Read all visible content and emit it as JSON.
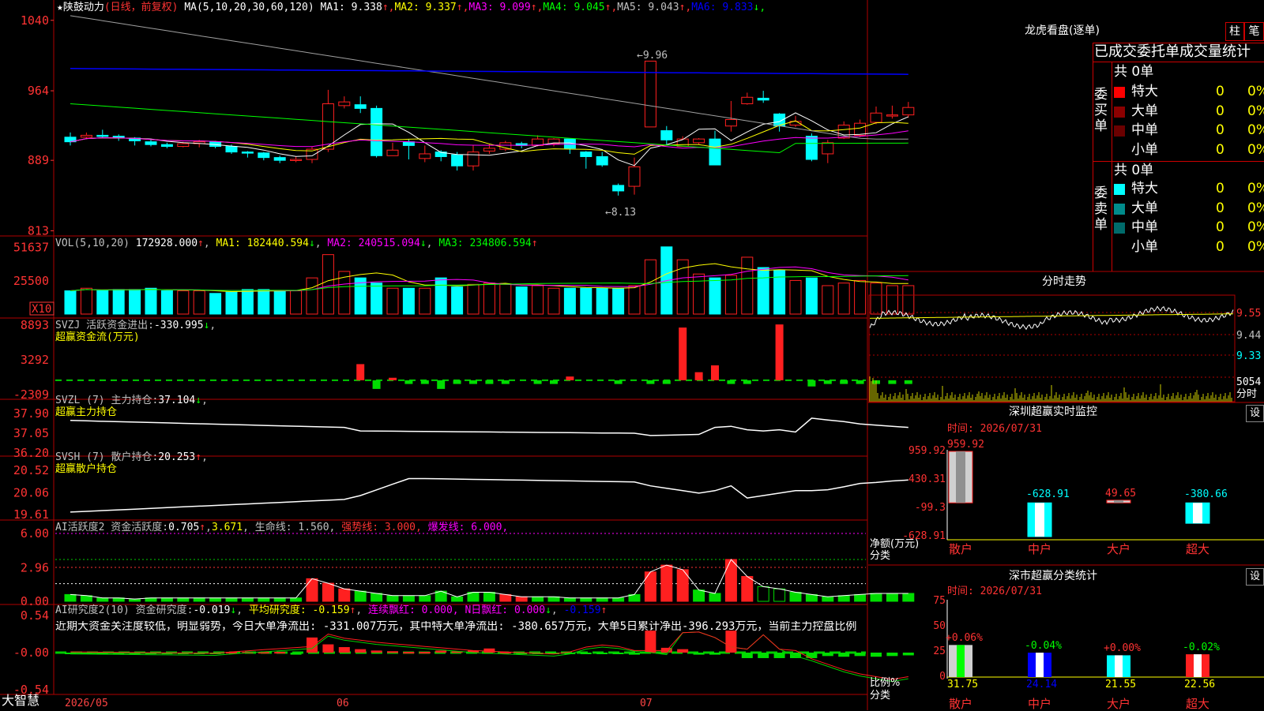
{
  "stock": {
    "name": "陕鼓动力",
    "mode": "(日线，前复权)"
  },
  "ma_header": {
    "label": "MA(5,10,20,30,60,120)",
    "items": [
      {
        "k": "MA1:",
        "v": "9.338",
        "arrow": "↑",
        "color": "#ffffff"
      },
      {
        "k": "MA2:",
        "v": "9.337",
        "arrow": "↑",
        "color": "#ffff00"
      },
      {
        "k": "MA3:",
        "v": "9.099",
        "arrow": "↑",
        "color": "#ff00ff"
      },
      {
        "k": "MA4:",
        "v": "9.045",
        "arrow": "↑",
        "color": "#00ff00"
      },
      {
        "k": "MA5:",
        "v": "9.043",
        "arrow": "↑",
        "color": "#c0c0c0"
      },
      {
        "k": "MA6:",
        "v": "9.833",
        "arrow": "↓",
        "color": "#0000ff"
      }
    ]
  },
  "price_axis": [
    "1040",
    "964",
    "889",
    "813"
  ],
  "price_marks": {
    "high": "9.96",
    "low": "8.13"
  },
  "vol_header": {
    "label": "VOL(5,10,20)",
    "v": "172928.000",
    "ma1": "182440.594",
    "ma2": "240515.094",
    "ma3": "234806.594"
  },
  "vol_axis": [
    "51637",
    "25500",
    "X10"
  ],
  "svzj": {
    "label": "SVZJ  活跃资金进出:",
    "v": "-330.995",
    "sub": "超赢资金流(万元)",
    "axis": [
      "8893",
      "3292",
      "-2309"
    ]
  },
  "svzl": {
    "label": "SVZL (7) 主力持仓:",
    "v": "37.104",
    "sub": "超赢主力持仓",
    "axis": [
      "37.90",
      "37.05",
      "36.20"
    ]
  },
  "svsh": {
    "label": "SVSH (7) 散户持仓:",
    "v": "20.253",
    "sub": "超赢散户持仓",
    "axis": [
      "20.52",
      "20.06",
      "19.61"
    ]
  },
  "ai2": {
    "label": "AI活跃度2 资金活跃度:",
    "v1": "0.705",
    "v2": "3.671",
    "life": "生命线: 1.560,",
    "strong": "强势线: 3.000,",
    "burst": "爆发线: 6.000,",
    "axis": [
      "6.00",
      "2.96",
      "0.00"
    ]
  },
  "ai_research": {
    "label": "AI研究度2(10) 资金研究度:",
    "v": "-0.019",
    "avg": "平均研究度: -0.159",
    "cont": "连续飘红: 0.000,",
    "nday": "N日飘红: 0.000",
    "last": "-0.159",
    "axis": [
      "0.54",
      "-0.00",
      "-0.54"
    ],
    "comment": "近期大资金关注度较低，明显弱势，今日大单净流出: -331.007万元，其中特大单净流出: -380.657万元，大单5日累计净出-396.293万元，当前主力控盘比例"
  },
  "dates": [
    "2026/05",
    "06",
    "07"
  ],
  "brand": "大智慧",
  "longhu": {
    "title": "龙虎看盘(逐单)",
    "tab1": "柱",
    "tab2": "笔",
    "header": "已成交委托单成交量统计",
    "buy_label": "委买单",
    "sell_label": "委卖单",
    "buy_total": "共 0单",
    "sell_total": "共 0单",
    "buy_rows": [
      {
        "name": "特大",
        "n": "0",
        "p": "0%"
      },
      {
        "name": "大单",
        "n": "0",
        "p": "0%"
      },
      {
        "name": "中单",
        "n": "0",
        "p": "0%"
      },
      {
        "name": "小单",
        "n": "0",
        "p": "0%"
      }
    ],
    "sell_rows": [
      {
        "name": "特大",
        "n": "0",
        "p": "0%"
      },
      {
        "name": "大单",
        "n": "0",
        "p": "0%"
      },
      {
        "name": "中单",
        "n": "0",
        "p": "0%"
      },
      {
        "name": "小单",
        "n": "0",
        "p": "0%"
      }
    ]
  },
  "fenshi": {
    "title": "分时走势",
    "axis": [
      "9.55",
      "9.44",
      "9.33"
    ],
    "vol": "5054",
    "vol_unit": "分时"
  },
  "monitor": {
    "title": "深圳超赢实时监控",
    "btn": "设",
    "time": "时间: 2026/07/31",
    "axis": [
      "959.92",
      "430.31",
      "-99.3",
      "-628.91"
    ],
    "unit": "净额(万元)",
    "cat": "分类",
    "bars": [
      {
        "name": "散户",
        "v": 959.92,
        "label": "959.92"
      },
      {
        "name": "中户",
        "v": -628.91,
        "label": "-628.91"
      },
      {
        "name": "大户",
        "v": 49.65,
        "label": "49.65"
      },
      {
        "name": "超大",
        "v": -380.66,
        "label": "-380.66"
      }
    ]
  },
  "classify": {
    "title": "深市超赢分类统计",
    "btn": "设",
    "time": "时间: 2026/07/31",
    "axis": [
      "75",
      "50",
      "25",
      "0"
    ],
    "unit": "比例%",
    "cat": "分类",
    "bars": [
      {
        "name": "散户",
        "v": 31.75,
        "chg": "+0.06%",
        "label": "31.75"
      },
      {
        "name": "中户",
        "v": 24.14,
        "chg": "-0.04%",
        "label": "24.14"
      },
      {
        "name": "大户",
        "v": 21.55,
        "chg": "+0.00%",
        "label": "21.55"
      },
      {
        "name": "超大",
        "v": 22.56,
        "chg": "-0.02%",
        "label": "22.56"
      }
    ]
  },
  "chart_data": {
    "type": "candlestick",
    "candles": [
      [
        9.14,
        9.09,
        9.19,
        9.05
      ],
      [
        9.14,
        9.16,
        9.19,
        9.12
      ],
      [
        9.16,
        9.15,
        9.22,
        9.13
      ],
      [
        9.15,
        9.13,
        9.17,
        9.1
      ],
      [
        9.13,
        9.1,
        9.14,
        9.05
      ],
      [
        9.09,
        9.06,
        9.12,
        9.04
      ],
      [
        9.06,
        9.04,
        9.08,
        9.02
      ],
      [
        9.04,
        9.07,
        9.09,
        9.03
      ],
      [
        9.07,
        9.09,
        9.11,
        9.03
      ],
      [
        9.09,
        9.04,
        9.1,
        9.02
      ],
      [
        9.04,
        8.98,
        9.06,
        8.96
      ],
      [
        8.98,
        8.97,
        8.99,
        8.92
      ],
      [
        8.97,
        8.92,
        8.98,
        8.89
      ],
      [
        8.92,
        8.89,
        8.94,
        8.86
      ],
      [
        8.89,
        8.9,
        8.93,
        8.87
      ],
      [
        8.9,
        9.01,
        9.04,
        8.86
      ],
      [
        9.01,
        9.5,
        9.65,
        8.98
      ],
      [
        9.48,
        9.52,
        9.58,
        9.45
      ],
      [
        9.49,
        9.45,
        9.58,
        9.4
      ],
      [
        9.45,
        8.94,
        9.48,
        8.92
      ],
      [
        8.94,
        9.0,
        9.08,
        8.98
      ],
      [
        9.09,
        9.05,
        9.12,
        8.9
      ],
      [
        8.91,
        8.96,
        9.05,
        8.87
      ],
      [
        8.98,
        8.93,
        9.0,
        8.88
      ],
      [
        8.95,
        8.83,
        8.98,
        8.78
      ],
      [
        8.83,
        8.98,
        9.05,
        8.78
      ],
      [
        8.99,
        9.02,
        9.07,
        8.96
      ],
      [
        9.01,
        9.08,
        9.1,
        8.99
      ],
      [
        9.07,
        9.05,
        9.09,
        9.02
      ],
      [
        9.05,
        9.12,
        9.16,
        9.04
      ],
      [
        9.07,
        9.12,
        9.13,
        9.04
      ],
      [
        9.12,
        9.02,
        9.12,
        8.96
      ],
      [
        8.98,
        8.93,
        8.99,
        8.8
      ],
      [
        8.93,
        8.84,
        8.98,
        8.82
      ],
      [
        8.62,
        8.56,
        8.64,
        8.51
      ],
      [
        8.61,
        8.82,
        8.92,
        8.52
      ],
      [
        9.25,
        9.96,
        9.96,
        9.25
      ],
      [
        9.21,
        9.11,
        9.26,
        9.05
      ],
      [
        9.04,
        9.12,
        9.15,
        9.04
      ],
      [
        9.08,
        9.12,
        9.13,
        9.06
      ],
      [
        9.12,
        8.84,
        9.21,
        8.9
      ],
      [
        9.26,
        9.33,
        9.53,
        9.2
      ],
      [
        9.5,
        9.57,
        9.62,
        9.49
      ],
      [
        9.56,
        9.54,
        9.64,
        9.51
      ],
      [
        9.39,
        9.26,
        9.4,
        9.2
      ],
      [
        9.27,
        9.31,
        9.37,
        9.25
      ],
      [
        9.15,
        8.9,
        9.18,
        8.88
      ],
      [
        8.96,
        9.08,
        9.11,
        8.86
      ],
      [
        9.13,
        9.27,
        9.31,
        9.12
      ],
      [
        9.16,
        9.29,
        9.33,
        9.14
      ],
      [
        9.3,
        9.4,
        9.47,
        9.28
      ],
      [
        9.37,
        9.38,
        9.48,
        9.34
      ],
      [
        9.38,
        9.46,
        9.52,
        9.35
      ]
    ]
  }
}
